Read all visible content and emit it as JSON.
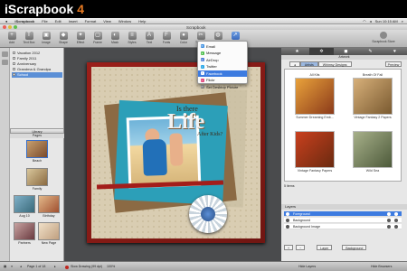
{
  "headline": {
    "app": "iScrapbook",
    "version": "4"
  },
  "menubar": {
    "items": [
      "iScrapbook",
      "File",
      "Edit",
      "Insert",
      "Format",
      "View",
      "Window",
      "Help"
    ],
    "right": {
      "time": "Sun 10:15 AM"
    }
  },
  "window": {
    "title": "Scrapbook"
  },
  "toolbar": {
    "buttons": [
      "Add",
      "Text Box",
      "Image",
      "Shape",
      "Effect",
      "Frame",
      "Mask",
      "Styles",
      "Text",
      "Fonts",
      "Color",
      "Trim Off",
      "Colorize",
      "Share"
    ],
    "account": "Scrapbook Store"
  },
  "library": {
    "items": [
      {
        "label": "Vacation 2012",
        "selected": false
      },
      {
        "label": "Family 2011",
        "selected": false
      },
      {
        "label": "Anniversary",
        "selected": false
      },
      {
        "label": "Grandma & Grandpa",
        "selected": false
      },
      {
        "label": "School",
        "selected": true
      }
    ],
    "header": "Library",
    "pages_header": "Pages",
    "thumbs": [
      "Beach",
      "Family",
      "Aug 10",
      "Birthday",
      "Partners",
      "New Page"
    ]
  },
  "canvas": {
    "title_top": "Is there",
    "title_main": "Life",
    "title_bottom": "After Kids?"
  },
  "share_menu": {
    "items": [
      {
        "label": "Email",
        "icon": "email-icon",
        "color": "#3b8ee0",
        "highlight": false
      },
      {
        "label": "Message",
        "icon": "message-icon",
        "color": "#4fbf4f",
        "highlight": false
      },
      {
        "label": "AirDrop",
        "icon": "airdrop-icon",
        "color": "#4a7ad6",
        "highlight": false
      },
      {
        "label": "Twitter",
        "icon": "twitter-icon",
        "color": "#2ea9e8",
        "highlight": false
      },
      {
        "label": "Facebook",
        "icon": "facebook-icon",
        "color": "#ffffff",
        "highlight": true
      },
      {
        "label": "Flickr",
        "icon": "flickr-icon",
        "color": "#e0447a",
        "highlight": false
      },
      {
        "label": "Set Desktop Picture",
        "icon": "desktop-icon",
        "color": "#7a7a7a",
        "highlight": false
      }
    ]
  },
  "artwork": {
    "tabs": [
      "★",
      "✲",
      "◼",
      "✎",
      "♥"
    ],
    "active_tab": 1,
    "header": "Artwork",
    "segments": [
      "Artists",
      "Whimsy Designs"
    ],
    "preview": "Preview",
    "all_kits": "All Kits",
    "breath_of_fall": "Breath Of Fall",
    "kits": [
      {
        "name": "Summer Dreaming Emb...",
        "color_a": "#e9a23b",
        "color_b": "#8b3a1a"
      },
      {
        "name": "Vintage Fantasy 2 Papers",
        "color_a": "#d7b07a",
        "color_b": "#7a5a30"
      },
      {
        "name": "Vintage Fantasy Papers",
        "color_a": "#c9401e",
        "color_b": "#6a2a10"
      },
      {
        "name": "Wild Sea",
        "color_a": "#a7b08a",
        "color_b": "#4d5a3a"
      }
    ],
    "items_count": "5 items"
  },
  "layers": {
    "header": "Layers",
    "rows": [
      {
        "label": "Foreground",
        "selected": true
      },
      {
        "label": "Background",
        "selected": false
      },
      {
        "label": "Background Image",
        "selected": false
      }
    ],
    "bar": [
      "+",
      "−",
      "Layer",
      "Background"
    ]
  },
  "status": {
    "page": "Page 1 of 18",
    "drawing": "Slow Drawing (99 dpi)",
    "zoom": "100%",
    "hide_layers": "Hide Layers",
    "hide_browsers": "Hide Browsers"
  }
}
